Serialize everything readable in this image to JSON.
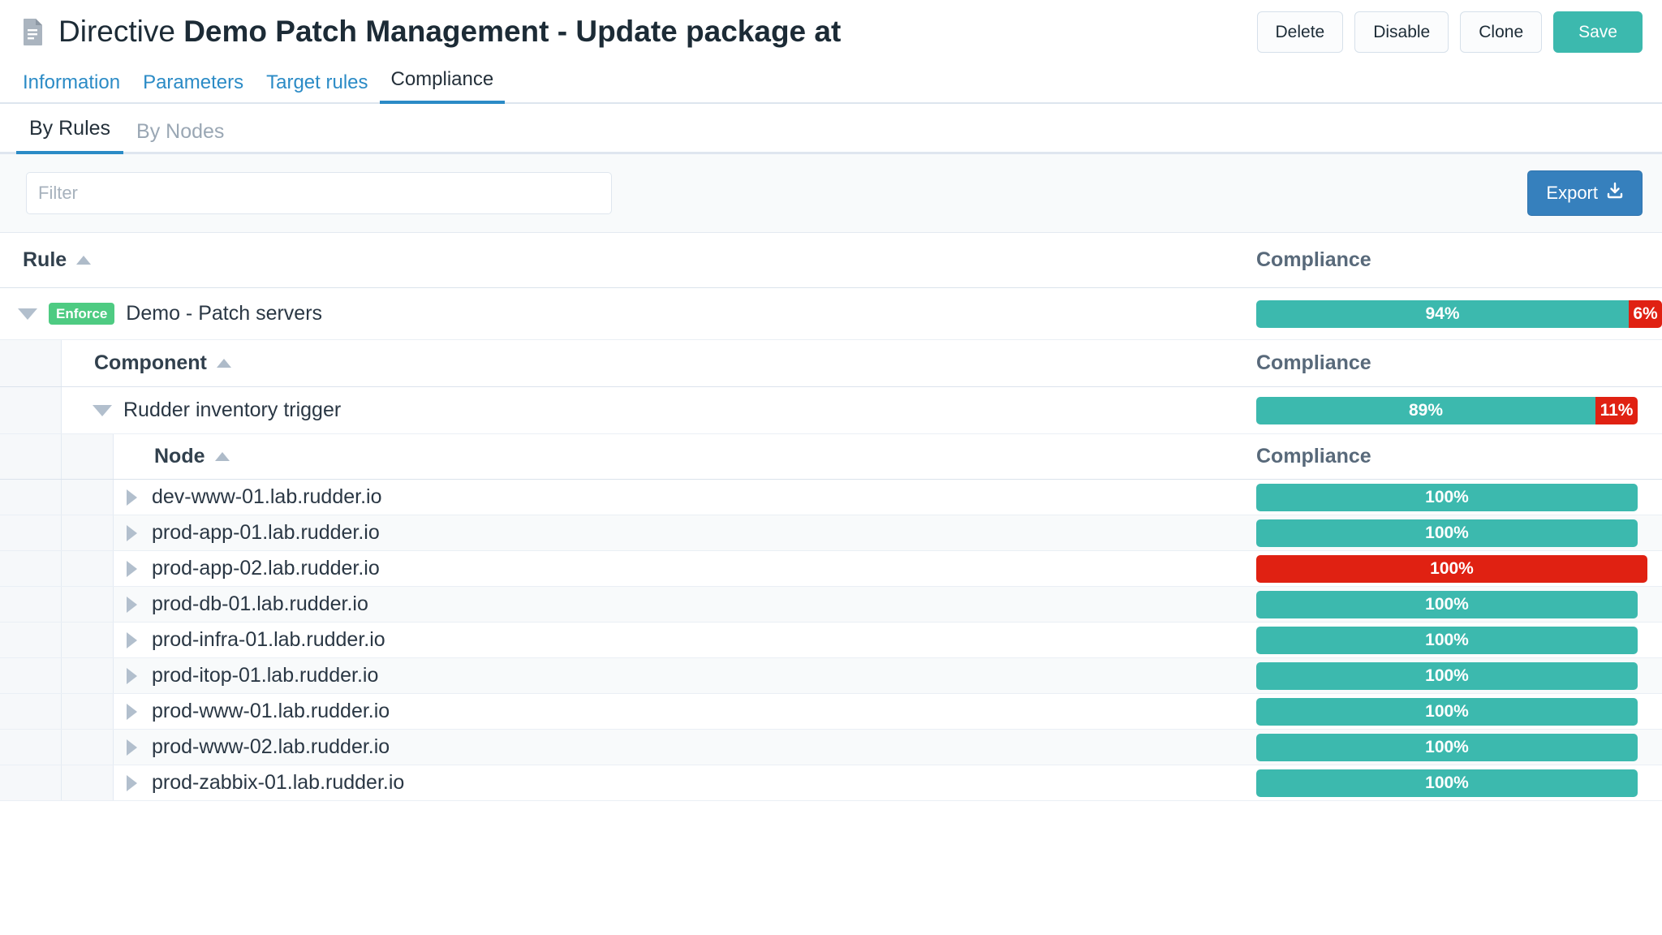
{
  "header": {
    "icon": "document-icon",
    "title_prefix": "Directive ",
    "title_main": "Demo Patch Management - Update package at",
    "buttons": [
      {
        "label": "Delete",
        "name": "delete-button"
      },
      {
        "label": "Disable",
        "name": "disable-button"
      },
      {
        "label": "Clone",
        "name": "clone-button"
      },
      {
        "label": "Save",
        "name": "save-button"
      }
    ]
  },
  "main_tabs": [
    {
      "label": "Information",
      "active": false
    },
    {
      "label": "Parameters",
      "active": false
    },
    {
      "label": "Target rules",
      "active": false
    },
    {
      "label": "Compliance",
      "active": true
    }
  ],
  "sub_tabs": [
    {
      "label": "By Rules",
      "active": true
    },
    {
      "label": "By Nodes",
      "active": false
    }
  ],
  "filter": {
    "placeholder": "Filter",
    "value": "",
    "export_label": "Export",
    "export_icon": "download-icon"
  },
  "colors": {
    "compliant": "#3cb9ae",
    "error": "#e02112",
    "enforce_badge": "#4ecb82",
    "export_blue": "#3680bd",
    "save_teal": "#3cb9ae",
    "tab_link": "#2b8bc6"
  },
  "table": {
    "rule_header": {
      "label": "Rule",
      "compliance_label": "Compliance"
    },
    "component_header": {
      "label": "Component",
      "compliance_label": "Compliance"
    },
    "node_header": {
      "label": "Node",
      "compliance_label": "Compliance"
    },
    "rule": {
      "badge": "Enforce",
      "name": "Demo - Patch servers",
      "compliance": [
        {
          "label": "94%",
          "value": 94,
          "status": "ok"
        },
        {
          "label": "6%",
          "value": 6,
          "status": "error"
        }
      ]
    },
    "component": {
      "name": "Rudder inventory trigger",
      "compliance": [
        {
          "label": "89%",
          "value": 89,
          "status": "ok"
        },
        {
          "label": "11%",
          "value": 11,
          "status": "error"
        }
      ]
    },
    "nodes": [
      {
        "name": "dev-www-01.lab.rudder.io",
        "compliance": [
          {
            "label": "100%",
            "value": 100,
            "status": "ok"
          }
        ]
      },
      {
        "name": "prod-app-01.lab.rudder.io",
        "compliance": [
          {
            "label": "100%",
            "value": 100,
            "status": "ok"
          }
        ]
      },
      {
        "name": "prod-app-02.lab.rudder.io",
        "compliance": [
          {
            "label": "100%",
            "value": 100,
            "status": "error"
          }
        ]
      },
      {
        "name": "prod-db-01.lab.rudder.io",
        "compliance": [
          {
            "label": "100%",
            "value": 100,
            "status": "ok"
          }
        ]
      },
      {
        "name": "prod-infra-01.lab.rudder.io",
        "compliance": [
          {
            "label": "100%",
            "value": 100,
            "status": "ok"
          }
        ]
      },
      {
        "name": "prod-itop-01.lab.rudder.io",
        "compliance": [
          {
            "label": "100%",
            "value": 100,
            "status": "ok"
          }
        ]
      },
      {
        "name": "prod-www-01.lab.rudder.io",
        "compliance": [
          {
            "label": "100%",
            "value": 100,
            "status": "ok"
          }
        ]
      },
      {
        "name": "prod-www-02.lab.rudder.io",
        "compliance": [
          {
            "label": "100%",
            "value": 100,
            "status": "ok"
          }
        ]
      },
      {
        "name": "prod-zabbix-01.lab.rudder.io",
        "compliance": [
          {
            "label": "100%",
            "value": 100,
            "status": "ok"
          }
        ]
      }
    ]
  }
}
